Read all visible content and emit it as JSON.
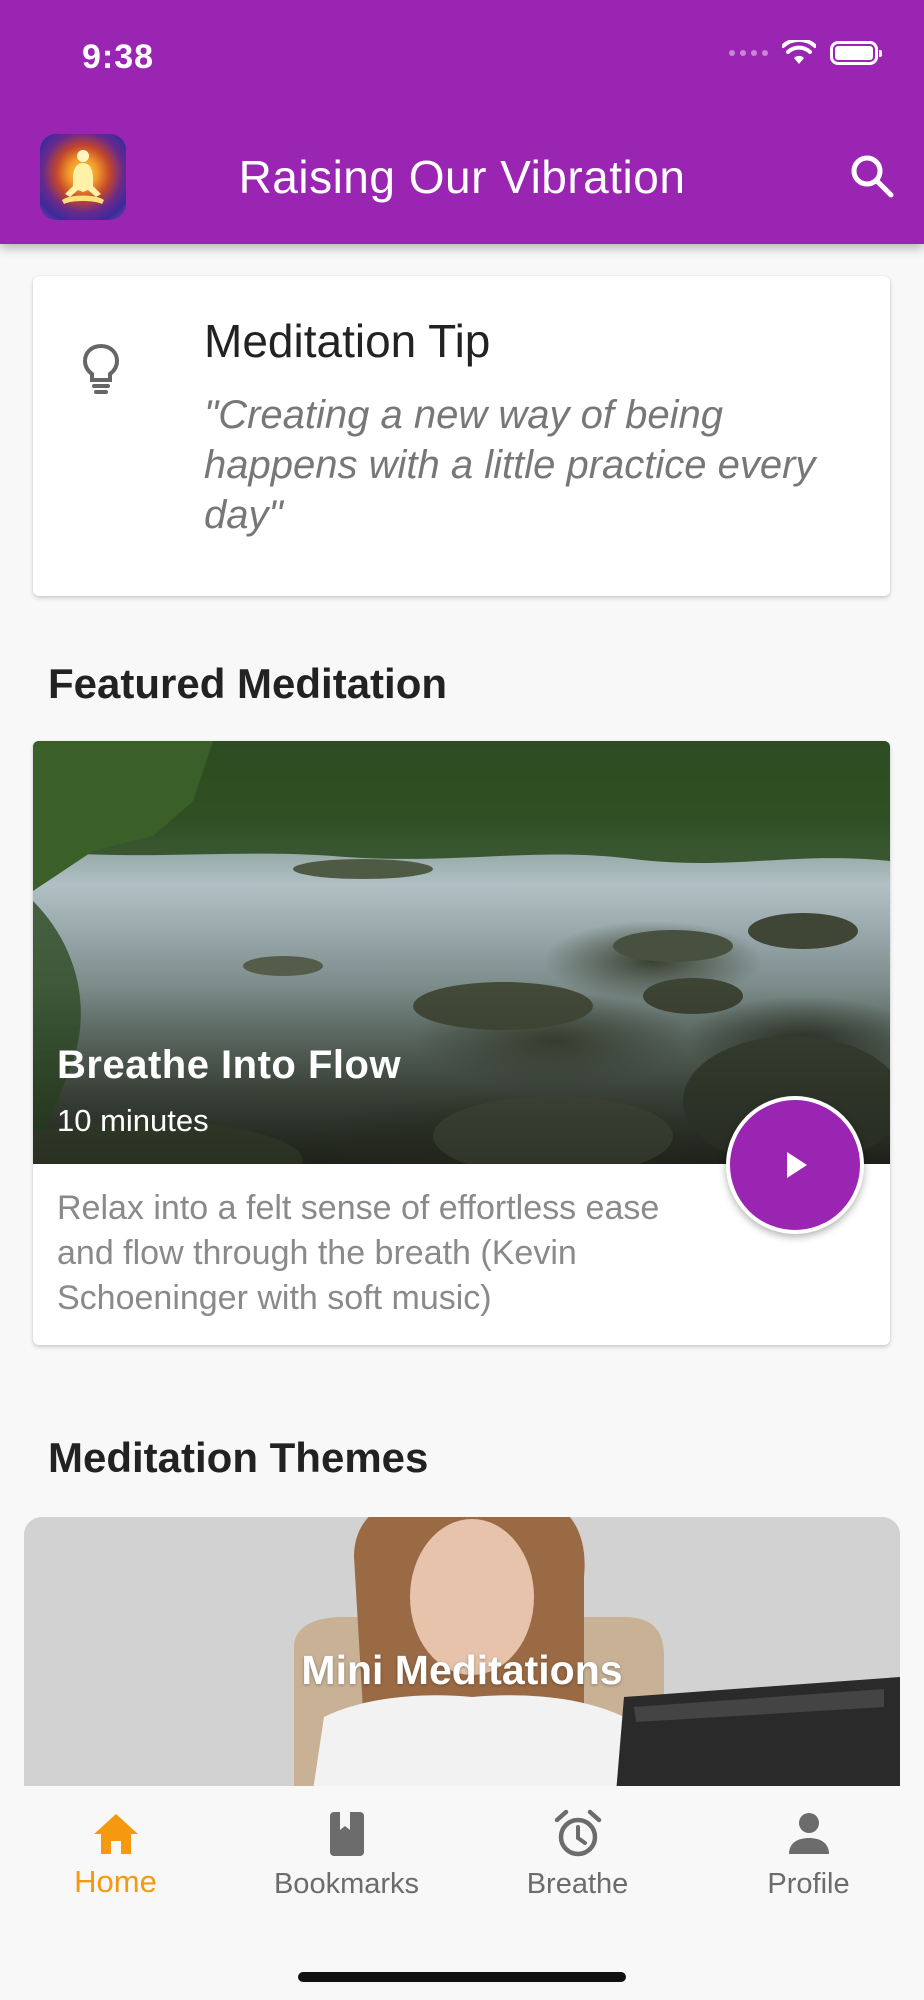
{
  "status_bar": {
    "time": "9:38"
  },
  "app_bar": {
    "title": "Raising Our Vibration"
  },
  "tip": {
    "heading": "Meditation Tip",
    "quote": "\"Creating a new way of being happens with a little practice every day\""
  },
  "featured": {
    "section_title": "Featured Meditation",
    "title": "Breathe Into Flow",
    "duration": "10 minutes",
    "description": "Relax into a felt sense of effortless ease and flow through the breath (Kevin Schoeninger with soft music)"
  },
  "themes": {
    "section_title": "Meditation Themes",
    "items": [
      {
        "label": "Mini Meditations"
      }
    ]
  },
  "bottom_nav": {
    "items": [
      {
        "label": "Home",
        "icon": "home-icon",
        "active": true
      },
      {
        "label": "Bookmarks",
        "icon": "bookmark-icon",
        "active": false
      },
      {
        "label": "Breathe",
        "icon": "alarm-clock-icon",
        "active": false
      },
      {
        "label": "Profile",
        "icon": "person-icon",
        "active": false
      }
    ]
  },
  "colors": {
    "primary": "#9b25b3",
    "accent_active": "#f59a10",
    "nav_inactive": "#6c6c6c",
    "background": "#f8f8f8"
  }
}
